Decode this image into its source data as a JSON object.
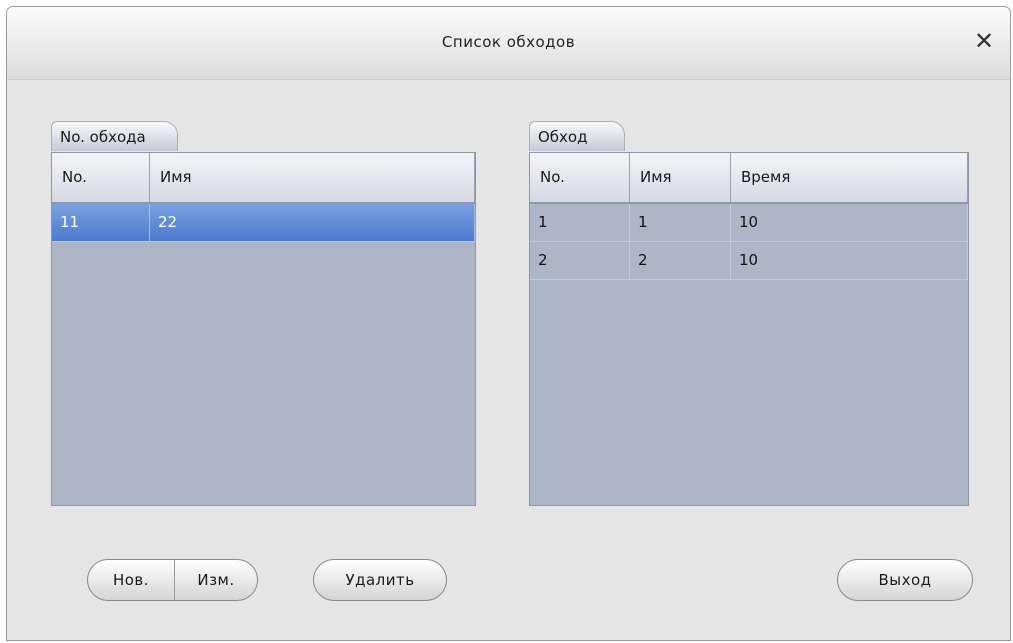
{
  "window": {
    "title": "Список обходов",
    "close_icon": "close-icon",
    "close_glyph": "✕"
  },
  "left_panel": {
    "tab_label": "No. обхода",
    "columns": [
      "No.",
      "Имя"
    ],
    "rows": [
      {
        "no": "11",
        "name": "22",
        "selected": true
      }
    ]
  },
  "right_panel": {
    "tab_label": "Обход",
    "columns": [
      "No.",
      "Имя",
      "Время"
    ],
    "rows": [
      {
        "no": "1",
        "name": "1",
        "time": "10"
      },
      {
        "no": "2",
        "name": "2",
        "time": "10"
      }
    ]
  },
  "buttons": {
    "new_label": "Нов.",
    "edit_label": "Изм.",
    "delete_label": "Удалить",
    "exit_label": "Выход"
  },
  "colors": {
    "selection": "#5b86d6",
    "panel_bg": "#aeb5c6",
    "dialog_bg": "#e5e5e5"
  }
}
